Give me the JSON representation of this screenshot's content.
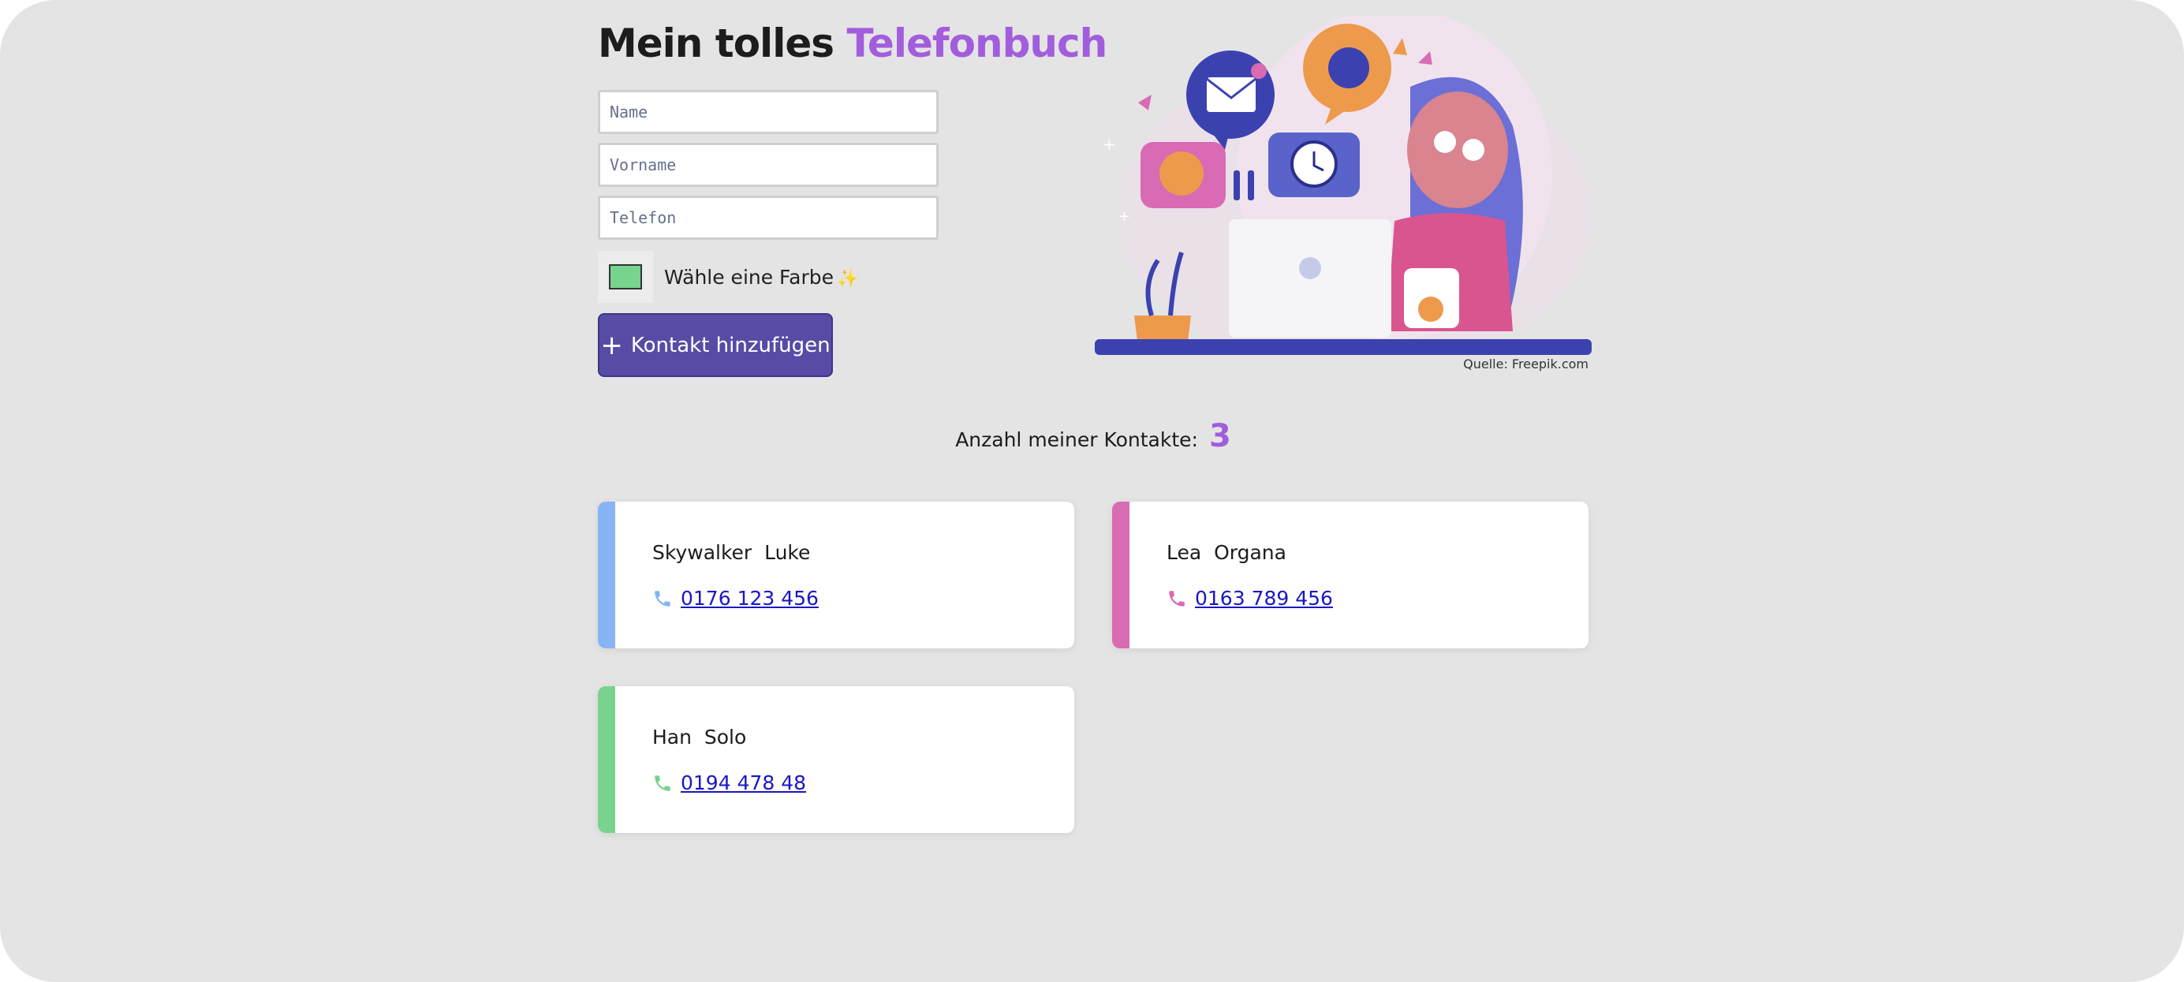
{
  "header": {
    "title_main": "Mein tolles",
    "title_accent": "Telefonbuch"
  },
  "form": {
    "name_placeholder": "Name",
    "vorname_placeholder": "Vorname",
    "telefon_placeholder": "Telefon",
    "color_label": "Wähle eine Farbe",
    "color_value": "#78d38f",
    "submit_label": "Kontakt hinzufügen"
  },
  "illustration": {
    "credit": "Quelle: Freepik.com"
  },
  "summary": {
    "count_label": "Anzahl meiner Kontakte:",
    "count_value": "3"
  },
  "contacts": [
    {
      "name": "Skywalker  Luke",
      "phone": "0176 123 456",
      "color": "#86b4f4"
    },
    {
      "name": "Lea  Organa",
      "phone": "0163 789 456",
      "color": "#d86bb4"
    },
    {
      "name": "Han  Solo",
      "phone": "0194 478 48",
      "color": "#78d38f"
    }
  ]
}
